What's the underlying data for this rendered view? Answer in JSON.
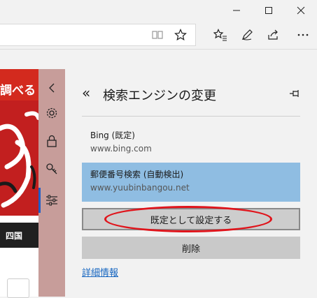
{
  "window": {
    "minimize_glyph": "—",
    "maximize_glyph": "☐",
    "close_glyph": "✕"
  },
  "page": {
    "banner_text": "調べる",
    "region_label": "四国"
  },
  "pane": {
    "back_glyph": "«",
    "title": "検索エンジンの変更",
    "engines": [
      {
        "name": "Bing (既定)",
        "url": "www.bing.com"
      },
      {
        "name": "郵便番号検索 (自動検出)",
        "url": "www.yuubinbangou.net"
      }
    ],
    "set_default_label": "既定として設定する",
    "remove_label": "削除",
    "details_link": "詳細情報"
  },
  "colors": {
    "accent": "#1e5ec8",
    "selected": "#8fbde2",
    "highlight_ring": "#e0141b"
  }
}
